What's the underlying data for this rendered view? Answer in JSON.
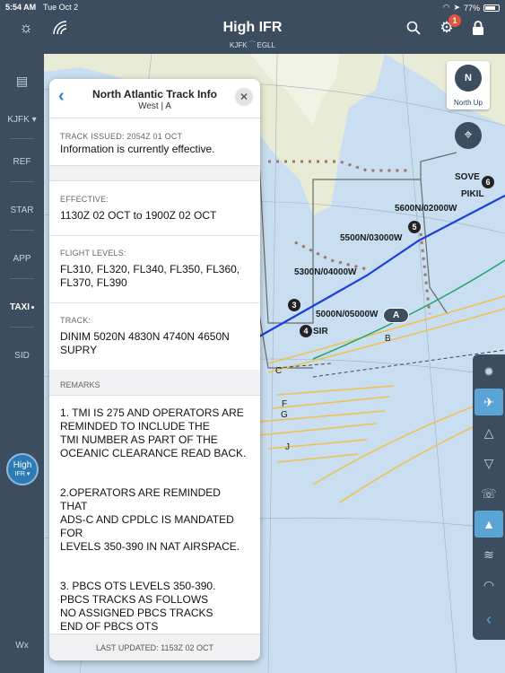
{
  "status": {
    "time": "5:54 AM",
    "date": "Tue Oct 2",
    "battery": "77%"
  },
  "header": {
    "title": "High IFR",
    "origin": "KJFK",
    "destination": "EGLL",
    "notification_count": "1"
  },
  "sidebar": {
    "airport": "KJFK ▾",
    "items": [
      "REF",
      "STAR",
      "APP",
      "TAXI",
      "SID"
    ],
    "chart_button": {
      "title": "High",
      "sub": "IFR ▾"
    },
    "wx": "Wx"
  },
  "map": {
    "north_up_label": "North Up",
    "north_letter": "N",
    "waypoints": {
      "sove": "SOVE",
      "pikil": "PIKIL",
      "w5600": "5600N/02000W",
      "w5500": "5500N/03000W",
      "w5300": "5300N/04000W",
      "w5000": "5000N/05000W",
      "sir": "SIR"
    },
    "track_letters": {
      "a": "A",
      "b": "B",
      "c": "C",
      "f": "F",
      "g": "G",
      "j": "J"
    },
    "markers": {
      "m3": "3",
      "m4": "4",
      "m5": "5",
      "m6": "6"
    }
  },
  "panel": {
    "title": "North Atlantic Track Info",
    "subtitle": "West | A",
    "track_issued_label": "TRACK ISSUED: 2054Z 01 OCT",
    "track_issued_value": "Information is currently effective.",
    "effective_label": "EFFECTIVE:",
    "effective_value": "1130Z 02 OCT to 1900Z 02 OCT",
    "flight_levels_label": "FLIGHT LEVELS:",
    "flight_levels_value": "FL310, FL320, FL340, FL350, FL360, FL370, FL390",
    "track_label": "TRACK:",
    "track_value": "DINIM 5020N 4830N 4740N 4650N SUPRY",
    "remarks_label": "REMARKS",
    "remark1": "1. TMI IS 275 AND OPERATORS ARE\nREMINDED TO INCLUDE THE\nTMI NUMBER AS PART OF THE\nOCEANIC CLEARANCE READ BACK.",
    "remark2": "2.OPERATORS ARE REMINDED THAT\nADS-C AND CPDLC IS MANDATED\nFOR\nLEVELS 350-390 IN NAT AIRSPACE.",
    "remark3": "3. PBCS OTS LEVELS 350-390.\nPBCS TRACKS AS FOLLOWS\nNO ASSIGNED PBCS TRACKS\nEND OF PBCS OTS",
    "last_updated": "LAST UPDATED:  1153Z 02 OCT"
  },
  "colors": {
    "chrome": "#3c4d5f",
    "accent": "#2b7ed6",
    "route": "#1d3fd8",
    "track": "#f0c04a",
    "land": "#e8ecd6",
    "water": "#c9def0"
  }
}
